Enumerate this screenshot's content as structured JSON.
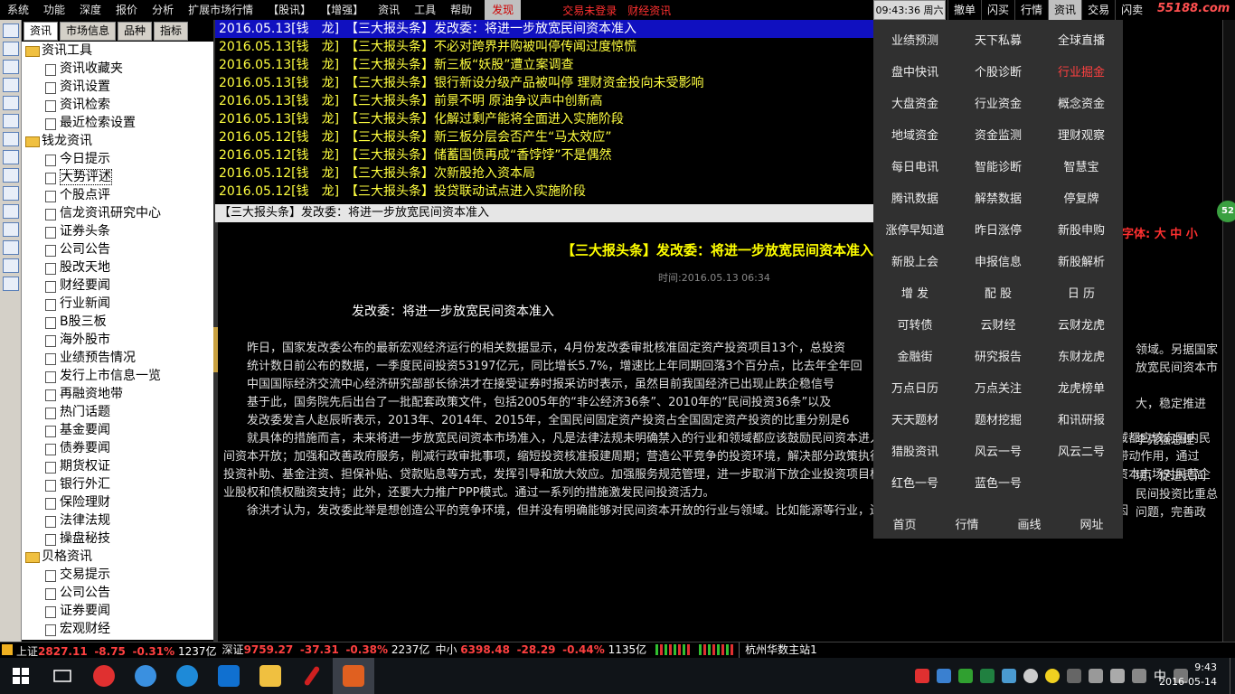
{
  "menu": {
    "items": [
      "系统",
      "功能",
      "深度",
      "报价",
      "分析",
      "扩展市场行情",
      "【股讯】",
      "【增强】",
      "资讯",
      "工具",
      "帮助"
    ],
    "active": "发现",
    "status_login": "交易未登录",
    "status_news": "财经资讯"
  },
  "clock": "09:43:36 周六",
  "right_tabs": [
    "撤单",
    "闪买",
    "行情",
    "资讯",
    "交易",
    "闪卖"
  ],
  "right_tab_active": "资讯",
  "site": "55188.com",
  "side_tabs": [
    "资讯",
    "市场信息",
    "品种",
    "指标"
  ],
  "left_icons": [
    "up-icon",
    "forward-icon",
    "down-icon",
    "quote-icon",
    "grid-icon",
    "line-chart-icon",
    "candle-icon",
    "bar-chart-icon",
    "f10-icon",
    "info-icon",
    "news-icon",
    "f12-icon",
    "fund-icon",
    "f0-icon",
    "gear-icon"
  ],
  "tree": [
    {
      "type": "fold",
      "label": "资讯工具"
    },
    {
      "type": "leaf",
      "label": "资讯收藏夹"
    },
    {
      "type": "leaf",
      "label": "资讯设置"
    },
    {
      "type": "leaf",
      "label": "资讯检索"
    },
    {
      "type": "leaf",
      "label": "最近检索设置"
    },
    {
      "type": "fold",
      "label": "钱龙资讯"
    },
    {
      "type": "leaf",
      "label": "今日提示"
    },
    {
      "type": "leaf",
      "label": "大势评述",
      "selected": true
    },
    {
      "type": "leaf",
      "label": "个股点评"
    },
    {
      "type": "leaf",
      "label": "信龙资讯研究中心"
    },
    {
      "type": "leaf",
      "label": "证券头条"
    },
    {
      "type": "leaf",
      "label": "公司公告"
    },
    {
      "type": "leaf",
      "label": "股改天地"
    },
    {
      "type": "leaf",
      "label": "财经要闻"
    },
    {
      "type": "leaf",
      "label": "行业新闻"
    },
    {
      "type": "leaf",
      "label": "B股三板"
    },
    {
      "type": "leaf",
      "label": "海外股市"
    },
    {
      "type": "leaf",
      "label": "业绩预告情况"
    },
    {
      "type": "leaf",
      "label": "发行上市信息一览"
    },
    {
      "type": "leaf",
      "label": "再融资地带"
    },
    {
      "type": "leaf",
      "label": "热门话题"
    },
    {
      "type": "leaf",
      "label": "基金要闻"
    },
    {
      "type": "leaf",
      "label": "债券要闻"
    },
    {
      "type": "leaf",
      "label": "期货权证"
    },
    {
      "type": "leaf",
      "label": "银行外汇"
    },
    {
      "type": "leaf",
      "label": "保险理财"
    },
    {
      "type": "leaf",
      "label": "法律法规"
    },
    {
      "type": "leaf",
      "label": "操盘秘技"
    },
    {
      "type": "fold",
      "label": "贝格资讯"
    },
    {
      "type": "leaf",
      "label": "交易提示"
    },
    {
      "type": "leaf",
      "label": "公司公告"
    },
    {
      "type": "leaf",
      "label": "证券要闻"
    },
    {
      "type": "leaf",
      "label": "宏观财经"
    }
  ],
  "news": [
    {
      "date": "2016.05.13[钱　龙]",
      "tag": "【三大报头条】",
      "title": "发改委：将进一步放宽民间资本准入",
      "selected": true
    },
    {
      "date": "2016.05.13[钱　龙]",
      "tag": "【三大报头条】",
      "title": "不必对跨界并购被叫停传闻过度惊慌"
    },
    {
      "date": "2016.05.13[钱　龙]",
      "tag": "【三大报头条】",
      "title": "新三板“妖股”遭立案调查"
    },
    {
      "date": "2016.05.13[钱　龙]",
      "tag": "【三大报头条】",
      "title": "银行新设分级产品被叫停 理财资金投向未受影响"
    },
    {
      "date": "2016.05.13[钱　龙]",
      "tag": "【三大报头条】",
      "title": "前景不明 原油争议声中创新高"
    },
    {
      "date": "2016.05.13[钱　龙]",
      "tag": "【三大报头条】",
      "title": "化解过剩产能将全面进入实施阶段"
    },
    {
      "date": "2016.05.12[钱　龙]",
      "tag": "【三大报头条】",
      "title": "新三板分层会否产生“马太效应”"
    },
    {
      "date": "2016.05.12[钱　龙]",
      "tag": "【三大报头条】",
      "title": "储蓄国债再成“香饽饽”不是偶然"
    },
    {
      "date": "2016.05.12[钱　龙]",
      "tag": "【三大报头条】",
      "title": "次新股抢入资本局"
    },
    {
      "date": "2016.05.12[钱　龙]",
      "tag": "【三大报头条】",
      "title": "投贷联动试点进入实施阶段"
    }
  ],
  "headline_bar": "【三大报头条】发改委：将进一步放宽民间资本准入",
  "article": {
    "title": "【三大报头条】发改委：将进一步放宽民间资本准入",
    "font_label": "字体:",
    "font_sizes": "大 中 小",
    "time": "时间:2016.05.13 06:34",
    "subtitle": "发改委：将进一步放宽民间资本准入",
    "paragraphs": [
      "昨日，国家发改委公布的最新宏观经济运行的相关数据显示，4月份发改委审批核准固定资产投资项目13个，总投资",
      "统计数日前公布的数据，一季度民间投资53197亿元，同比增长5.7%，增速比上年同期回落3个百分点，比去年全年回",
      "中国国际经济交流中心经济研究部部长徐洪才在接受证券时报采访时表示，虽然目前我国经济已出现止跌企稳信号",
      "基于此，国务院先后出台了一批配套政策文件，包括2005年的“非公经济36条”、2010年的“民间投资36条”以及",
      "发改委发言人赵辰昕表示，2013年、2014年、2015年，全国民间固定资产投资占全国固定资产投资的比重分别是6",
      "就具体的措施而言，未来将进一步放宽民间资本市场准入，凡是法律法规未明确禁入的行业和领域都应该鼓励民间资本进入，凡是我国政府已向外资开放或承诺开放的领域都应该向国内民间资本开放；加强和改善政府服务，削减行政审批事项，缩短投资核准报建周期；营造公平竞争的投资环境，解决部分政策执行中存在的“贴标签”现象；发挥政府投资的引导带动作用，通过投资补助、基金注资、担保补贴、贷款贴息等方式，发挥引导和放大效应。加强服务规范管理，进一步取消下放企业投资项目核准权限；加大对民间投资的融资支持，多层次资本市场对民营企业股权和债权融资支持；此外，还要大力推广PPP模式。通过一系列的措施激发民间投资活力。",
      "徐洪才认为，发改委此举是想创造公平的竞争环境，但并没有明确能够对民间资本开放的行业与领域。比如能源等行业，还会涉及到国企的垄断地位，开放起来有难度。因"
    ],
    "right_fragments": [
      "领域。另据国家",
      "放宽民间资本市",
      "大，稳定推进",
      "李克强总理",
      "境，促进民间",
      "民间投资比重总",
      "问题，完善政"
    ]
  },
  "popup": {
    "items": [
      {
        "label": "业绩预测"
      },
      {
        "label": "天下私募"
      },
      {
        "label": "全球直播"
      },
      {
        "label": "盘中快讯"
      },
      {
        "label": "个股诊断"
      },
      {
        "label": "行业掘金",
        "red": true
      },
      {
        "label": "大盘资金"
      },
      {
        "label": "行业资金"
      },
      {
        "label": "概念资金"
      },
      {
        "label": "地域资金"
      },
      {
        "label": "资金监测"
      },
      {
        "label": "理财观察"
      },
      {
        "label": "每日电讯"
      },
      {
        "label": "智能诊断"
      },
      {
        "label": "智慧宝"
      },
      {
        "label": "腾讯数据"
      },
      {
        "label": "解禁数据"
      },
      {
        "label": "停复牌"
      },
      {
        "label": "涨停早知道"
      },
      {
        "label": "昨日涨停"
      },
      {
        "label": "新股申购"
      },
      {
        "label": "新股上会"
      },
      {
        "label": "申报信息"
      },
      {
        "label": "新股解析"
      },
      {
        "label": "增 发"
      },
      {
        "label": "配 股"
      },
      {
        "label": "日 历"
      },
      {
        "label": "可转债"
      },
      {
        "label": "云财经"
      },
      {
        "label": "云财龙虎"
      },
      {
        "label": "金融街"
      },
      {
        "label": "研究报告"
      },
      {
        "label": "东财龙虎"
      },
      {
        "label": "万点日历"
      },
      {
        "label": "万点关注"
      },
      {
        "label": "龙虎榜单"
      },
      {
        "label": "天天题材"
      },
      {
        "label": "题材挖掘"
      },
      {
        "label": "和讯研报"
      },
      {
        "label": "猎股资讯"
      },
      {
        "label": "风云一号"
      },
      {
        "label": "风云二号"
      },
      {
        "label": "红色一号"
      },
      {
        "label": "蓝色一号"
      }
    ],
    "bottom": [
      "首页",
      "行情",
      "画线",
      "网址"
    ]
  },
  "badge": "52",
  "status": {
    "sh_label": "上证",
    "sh_val": "2827.11",
    "sh_chg": "-8.75",
    "sh_pct": "-0.31%",
    "sh_amt": "1237亿",
    "sz_label": "深证",
    "sz_val": "9759.27",
    "sz_chg": "-37.31",
    "sz_pct": "-0.38%",
    "sz_amt": "2237亿",
    "zx_label": "中小",
    "zx_val": "6398.48",
    "zx_chg": "-28.29",
    "zx_pct": "-0.44%",
    "zx_amt": "1135亿",
    "station": "杭州华数主站1"
  },
  "taskbar": {
    "ime": "中",
    "time": "9:43",
    "date": "2016-05-14"
  }
}
